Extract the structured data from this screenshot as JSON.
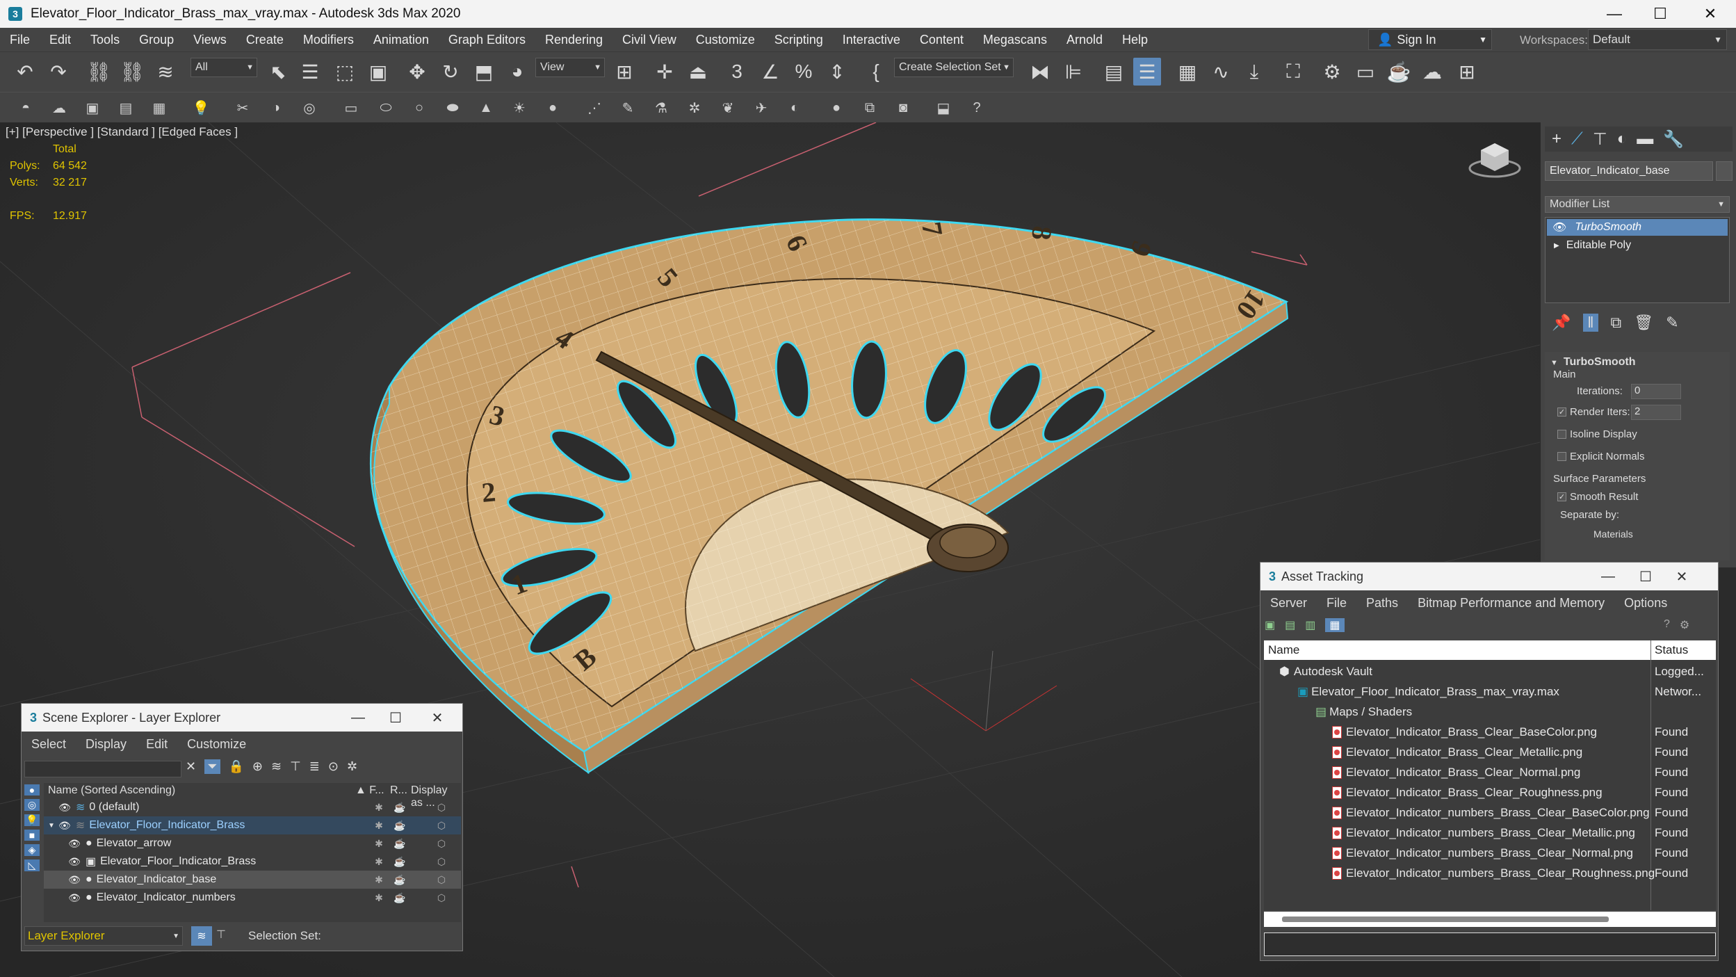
{
  "app": {
    "icon": "3ds-max-icon",
    "title": "Elevator_Floor_Indicator_Brass_max_vray.max - Autodesk 3ds Max 2020"
  },
  "menu": [
    "File",
    "Edit",
    "Tools",
    "Group",
    "Views",
    "Create",
    "Modifiers",
    "Animation",
    "Graph Editors",
    "Rendering",
    "Civil View",
    "Customize",
    "Scripting",
    "Interactive",
    "Content",
    "Megascans",
    "Arnold",
    "Help"
  ],
  "signin": "Sign In",
  "workspaces": {
    "label": "Workspaces:",
    "value": "Default"
  },
  "toolbar": {
    "filter": "All",
    "view": "View",
    "selection_set": "Create Selection Set"
  },
  "viewport": {
    "label": "[+] [Perspective ] [Standard ] [Edged Faces ]",
    "stats_header": "Total",
    "polys_label": "Polys:",
    "polys": "64 542",
    "verts_label": "Verts:",
    "verts": "32 217",
    "fps_label": "FPS:",
    "fps": "12.917",
    "dial_numbers": [
      "B",
      "1",
      "2",
      "3",
      "4",
      "5",
      "6",
      "7",
      "8",
      "9",
      "10"
    ]
  },
  "command_panel": {
    "object_name": "Elevator_Indicator_base",
    "modifier_list": "Modifier List",
    "stack": [
      "TurboSmooth",
      "Editable Poly"
    ],
    "rollout_title": "TurboSmooth",
    "main": "Main",
    "iterations_label": "Iterations:",
    "iterations": "0",
    "render_iters_label": "Render Iters:",
    "render_iters": "2",
    "isoline": "Isoline Display",
    "explicit": "Explicit Normals",
    "surface_params": "Surface Parameters",
    "smooth_result": "Smooth Result",
    "separate_by": "Separate by:",
    "materials": "Materials"
  },
  "asset_tracking": {
    "title": "Asset Tracking",
    "menu": [
      "Server",
      "File",
      "Paths",
      "Bitmap Performance and Memory",
      "Options"
    ],
    "col_name": "Name",
    "col_status": "Status",
    "rows": [
      {
        "name": "Autodesk Vault",
        "status": "Logged..."
      },
      {
        "name": "Elevator_Floor_Indicator_Brass_max_vray.max",
        "status": "Networ..."
      },
      {
        "name": "Maps / Shaders",
        "status": ""
      },
      {
        "name": "Elevator_Indicator_Brass_Clear_BaseColor.png",
        "status": "Found"
      },
      {
        "name": "Elevator_Indicator_Brass_Clear_Metallic.png",
        "status": "Found"
      },
      {
        "name": "Elevator_Indicator_Brass_Clear_Normal.png",
        "status": "Found"
      },
      {
        "name": "Elevator_Indicator_Brass_Clear_Roughness.png",
        "status": "Found"
      },
      {
        "name": "Elevator_Indicator_numbers_Brass_Clear_BaseColor.png",
        "status": "Found"
      },
      {
        "name": "Elevator_Indicator_numbers_Brass_Clear_Metallic.png",
        "status": "Found"
      },
      {
        "name": "Elevator_Indicator_numbers_Brass_Clear_Normal.png",
        "status": "Found"
      },
      {
        "name": "Elevator_Indicator_numbers_Brass_Clear_Roughness.png",
        "status": "Found"
      }
    ]
  },
  "scene_explorer": {
    "title": "Scene Explorer - Layer Explorer",
    "menu": [
      "Select",
      "Display",
      "Edit",
      "Customize"
    ],
    "col_name": "Name (Sorted Ascending)",
    "col_f": "▲ F...",
    "col_r": "R...",
    "col_display": "Display as ...",
    "rows": [
      {
        "name": "0 (default)"
      },
      {
        "name": "Elevator_Floor_Indicator_Brass"
      },
      {
        "name": "Elevator_arrow"
      },
      {
        "name": "Elevator_Floor_Indicator_Brass"
      },
      {
        "name": "Elevator_Indicator_base"
      },
      {
        "name": "Elevator_Indicator_numbers"
      }
    ],
    "footer_layer": "Layer Explorer",
    "footer_selset": "Selection Set:"
  },
  "colors": {
    "accent": "#5b87b8",
    "brass": "#d9b77a",
    "highlight": "#3fd8f0"
  }
}
